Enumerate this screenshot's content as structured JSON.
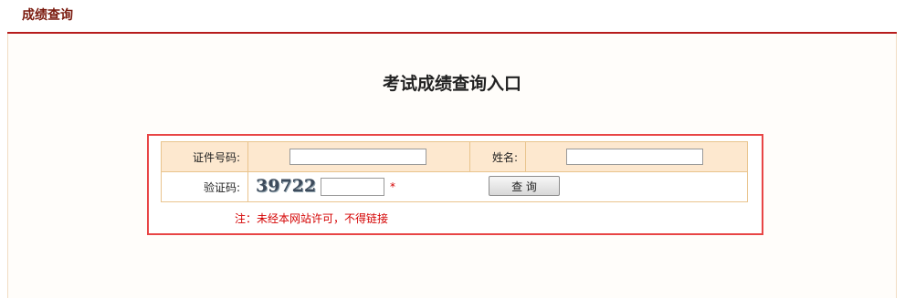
{
  "header": {
    "title": "成绩查询"
  },
  "main": {
    "heading": "考试成绩查询入口"
  },
  "form": {
    "id_number_label": "证件号码:",
    "id_number_value": "",
    "name_label": "姓名:",
    "name_value": "",
    "captcha_label": "验证码:",
    "captcha_text": "39722",
    "captcha_value": "",
    "required_mark": "*",
    "query_button_label": "查 询",
    "notice": "注：未经本网站许可，不得链接"
  },
  "colors": {
    "header_title": "#7a1a0e",
    "header_line": "#b71c1c",
    "frame_border": "#e84545",
    "row_highlight": "#fde8cf",
    "cell_border": "#e9c48d",
    "notice_text": "#d40000"
  }
}
